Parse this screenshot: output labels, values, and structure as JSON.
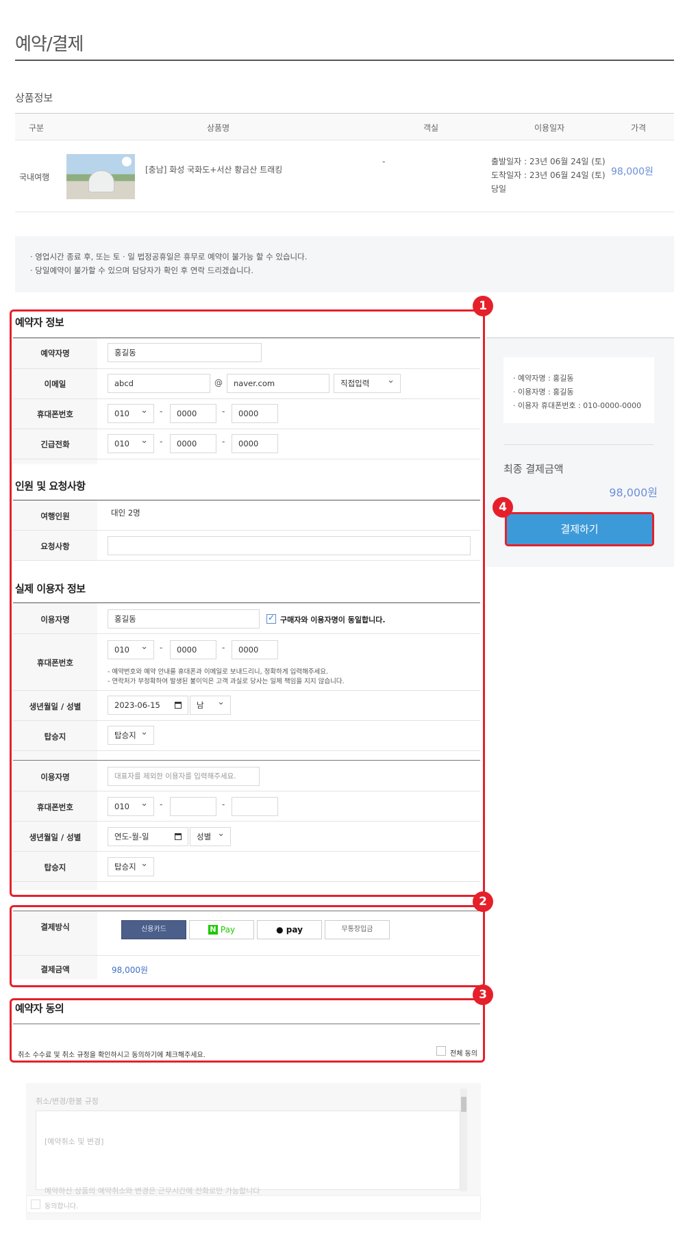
{
  "page": {
    "title": "예약/결제"
  },
  "product": {
    "heading": "상품정보",
    "columns": [
      "구분",
      "상품명",
      "객실",
      "이용일자",
      "가격"
    ],
    "row": {
      "category": "국내여행",
      "name": "[충남] 화성 국화도+서산 황금산 트래킹",
      "room": "-",
      "dates": [
        "출발일자 : 23년 06월 24일 (토)",
        "도착일자 : 23년 06월 24일 (토)",
        "당일"
      ],
      "price": "98,000원"
    }
  },
  "notice": [
    "· 영업시간 종료 후, 또는 토 · 일 법정공휴일은 휴무로 예약이 불가능 할 수 있습니다.",
    "· 당일예약이 불가할 수 있으며 담당자가 확인 후 연락 드리겠습니다."
  ],
  "badges": [
    "1",
    "2",
    "3",
    "4"
  ],
  "booker": {
    "title": "예약자 정보",
    "name_label": "예약자명",
    "name_value": "홍길동",
    "email_label": "이메일",
    "email_id": "abcd",
    "email_at": "@",
    "email_domain": "naver.com",
    "email_select": "직접입력",
    "phone_label": "휴대폰번호",
    "phone": [
      "010",
      "0000",
      "0000"
    ],
    "emergency_label": "긴급전화",
    "emergency": [
      "010",
      "0000",
      "0000"
    ]
  },
  "party": {
    "title": "인원 및 요청사항",
    "travelers_label": "여행인원",
    "travelers_value": "대인 2명",
    "request_label": "요청사항",
    "request_value": ""
  },
  "users": {
    "title": "실제 이용자 정보",
    "user1": {
      "name_label": "이용자명",
      "name_value": "홍길동",
      "same_check_label": "구매자와 이용자명이 동일합니다.",
      "phone_label": "휴대폰번호",
      "phone": [
        "010",
        "0000",
        "0000"
      ],
      "help": [
        "- 예약번호와 예약 안내를 휴대폰과 이메일로 보내드리니, 정확하게 입력해주세요.",
        "- 연락처가 부정확하여 발생된 불이익은 고객 과실로 당사는 일체 책임을 지지 않습니다."
      ],
      "birth_label": "생년월일 / 성별",
      "birth_value": "2023-06-15",
      "gender": "남",
      "pickup_label": "탑승지",
      "pickup": "탑승지"
    },
    "user2": {
      "name_label": "이용자명",
      "name_placeholder": "대표자를 제외한 이용자를 입력해주세요.",
      "phone_label": "휴대폰번호",
      "phone": [
        "010",
        "",
        ""
      ],
      "birth_label": "생년월일 / 성별",
      "birth_placeholder": "연도-월-일",
      "gender": "성별",
      "pickup_label": "탑승지",
      "pickup": "탑승지"
    }
  },
  "payment": {
    "method_label": "결제방식",
    "methods": [
      "신용카드",
      "N",
      "Pay",
      "pay",
      "무통장입금"
    ],
    "amount_label": "결제금액",
    "amount": "98,000원"
  },
  "consent": {
    "title": "예약자 동의",
    "instruction": "취소 수수료 및 취소 규정을 확인하시고 동의하기에 체크해주세요.",
    "all_agree": "전체 동의",
    "terms_title": "취소/변경/환불 규정",
    "terms_subheading": "[예약취소 및 변경]",
    "terms_line": "예약하신 상품의 예약취소와 변경은 근무시간에 전화로만 가능합니다",
    "agree_label": "동의합니다."
  },
  "summary": {
    "lines": [
      "· 예약자명 : 홍길동",
      "· 이용자명 : 홍길동",
      "· 이용자 휴대폰번호 : 010-0000-0000"
    ],
    "final_label": "최종 결제금액",
    "final_amount": "98,000원",
    "pay_button": "결제하기"
  },
  "colors": {
    "accent_red": "#e5202a",
    "button_blue": "#3d9ad9",
    "price_blue": "#6a8fd8",
    "active_method": "#4b5f8a",
    "npay_green": "#1ec800"
  }
}
